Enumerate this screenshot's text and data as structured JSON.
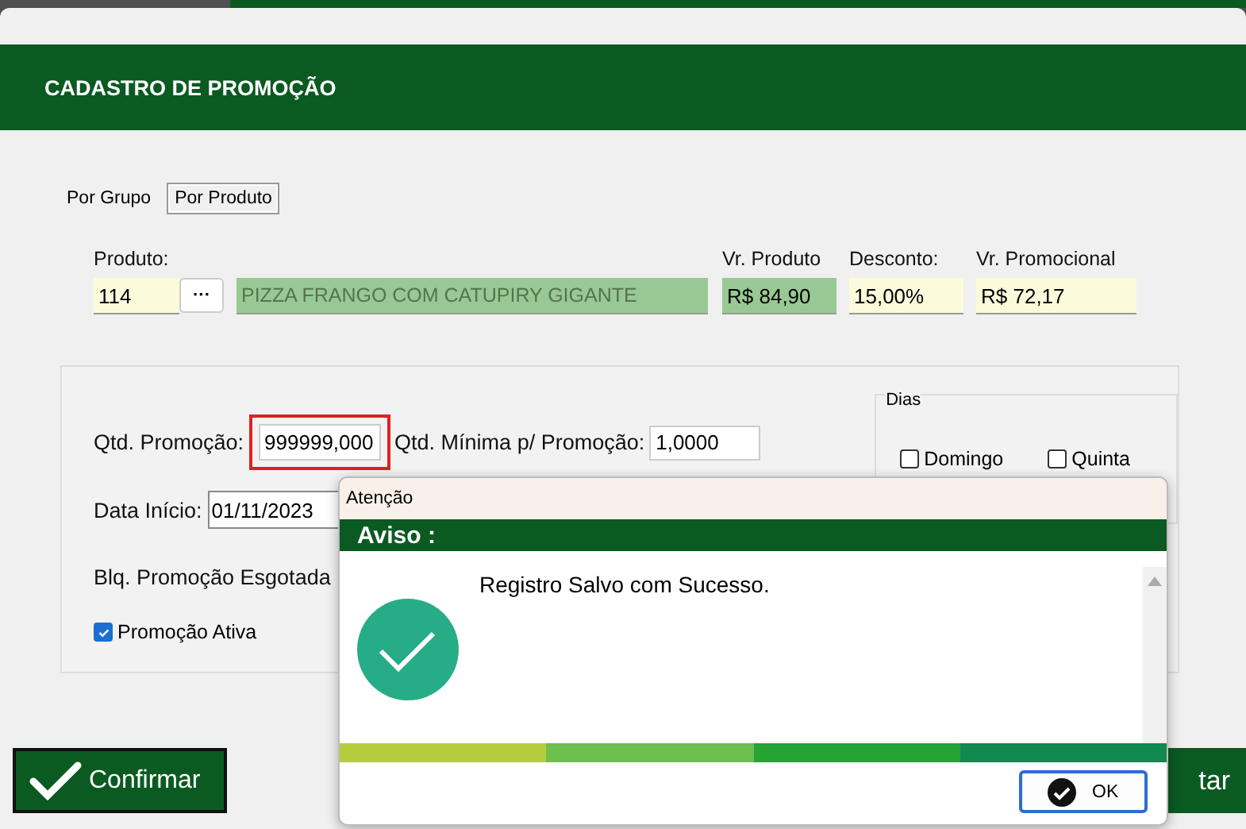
{
  "window": {
    "title": "CADASTRO DE PROMOÇÃO"
  },
  "tabs": [
    {
      "label": "Por Grupo",
      "selected": false
    },
    {
      "label": "Por Produto",
      "selected": true
    }
  ],
  "product": {
    "label": "Produto:",
    "code": "114",
    "browse_button": "···",
    "name": "PIZZA FRANGO COM CATUPIRY GIGANTE",
    "price_label": "Vr. Produto",
    "price": "R$ 84,90",
    "discount_label": "Desconto:",
    "discount": "15,00%",
    "promo_price_label": "Vr. Promocional",
    "promo_price": "R$ 72,17"
  },
  "promotion": {
    "qty_label": "Qtd. Promoção:",
    "qty": "999999,000",
    "qty_error": true,
    "min_qty_label": "Qtd. Mínima p/ Promoção:",
    "min_qty": "1,0000",
    "start_label": "Data Início:",
    "start": "01/11/2023",
    "block_label": "Blq. Promoção Esgotada",
    "active_label": "Promoção Ativa",
    "active_checked": true
  },
  "days": {
    "title": "Dias",
    "items": [
      {
        "label": "Domingo",
        "checked": false
      },
      {
        "label": "Quinta",
        "checked": false
      }
    ]
  },
  "buttons": {
    "confirm": "Confirmar",
    "right_partial": "tar"
  },
  "dialog": {
    "title": "Atenção",
    "heading": "Aviso :",
    "message": "Registro Salvo com Sucesso.",
    "ok": "OK"
  }
}
